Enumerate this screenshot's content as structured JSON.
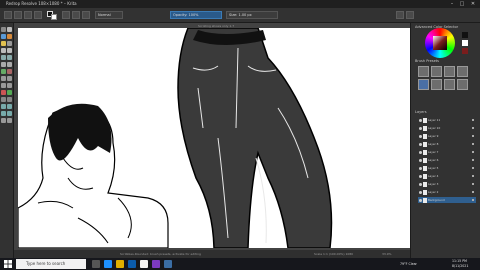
{
  "window": {
    "title": "Redrop Resolve 108×1080 * – Krita",
    "minimize_icon": "minimize-icon",
    "maximize_icon": "maximize-icon",
    "close_icon": "close-icon"
  },
  "toolbar": {
    "opacity_label": "Opacity: 100%",
    "size_label": "Size: 1.00 px",
    "blend_label": "Normal"
  },
  "canvas": {
    "hint": "Scrolling shows only 1.7",
    "status_left": "Scribbles-Rounded: brush presets, activate for editing",
    "status_mid": "Scale 1:1 (100.00%) 1080",
    "status_right": "33.9%"
  },
  "right_dock": {
    "advanced_color_title": "Advanced Color Selector",
    "brush_presets_title": "Brush Presets",
    "layers_title": "Layers",
    "layers": [
      {
        "name": "Layer 11"
      },
      {
        "name": "Layer 10"
      },
      {
        "name": "Layer 9"
      },
      {
        "name": "Layer 8"
      },
      {
        "name": "Layer 7"
      },
      {
        "name": "Layer 6"
      },
      {
        "name": "Layer 5"
      },
      {
        "name": "Layer 4"
      },
      {
        "name": "Layer 3"
      },
      {
        "name": "Layer 2"
      },
      {
        "name": "Background"
      }
    ]
  },
  "taskbar": {
    "search_placeholder": "Type here to search",
    "weather": "79°F Clear",
    "time": "11:15 PM",
    "date": "8/11/2021"
  },
  "colors": {
    "accent": "#2f5f8f",
    "dock_bg": "#323232",
    "canvas_bg": "#ffffff"
  }
}
